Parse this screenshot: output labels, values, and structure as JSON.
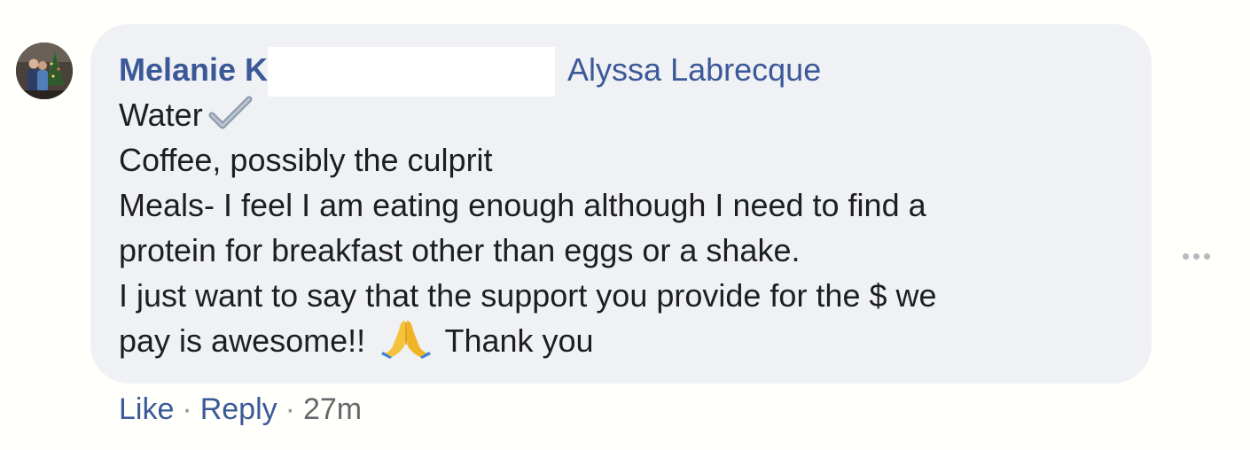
{
  "comment": {
    "author": "Melanie K",
    "tagged_user": "Alyssa Labrecque",
    "lines": [
      "Water",
      "Coffee, possibly the culprit",
      "Meals- I feel I am eating enough although I need to find a",
      "protein for breakfast other than eggs or a shake.",
      "I just want to say that the support you provide for the $ we",
      "pay is awesome!!"
    ],
    "line_end": "Thank you",
    "emojis": [
      "check-mark-icon",
      "folded-hands-icon"
    ]
  },
  "actions": {
    "like": "Like",
    "separator": "·",
    "reply": "Reply",
    "timestamp": "27m"
  },
  "colors": {
    "link": "#3b5998",
    "bubble": "#f0f1f4",
    "text": "#1c1e21",
    "meta": "#65676b"
  }
}
